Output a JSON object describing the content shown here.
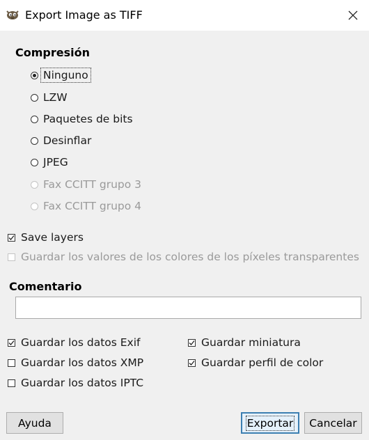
{
  "window": {
    "title": "Export Image as TIFF"
  },
  "compression": {
    "title": "Compresión",
    "options": [
      {
        "label": "Ninguno",
        "checked": true,
        "disabled": false
      },
      {
        "label": "LZW",
        "checked": false,
        "disabled": false
      },
      {
        "label": "Paquetes de bits",
        "checked": false,
        "disabled": false
      },
      {
        "label": "Desinflar",
        "checked": false,
        "disabled": false
      },
      {
        "label": "JPEG",
        "checked": false,
        "disabled": false
      },
      {
        "label": "Fax CCITT grupo 3",
        "checked": false,
        "disabled": true
      },
      {
        "label": "Fax CCITT grupo 4",
        "checked": false,
        "disabled": true
      }
    ]
  },
  "save_layers": {
    "label": "Save layers",
    "checked": true
  },
  "save_transparent": {
    "label": "Guardar los valores de los colores de los píxeles transparentes",
    "checked": false,
    "disabled": true
  },
  "comment": {
    "title": "Comentario",
    "value": ""
  },
  "metadata": {
    "exif": {
      "label": "Guardar los datos Exif",
      "checked": true
    },
    "xmp": {
      "label": "Guardar los datos XMP",
      "checked": false
    },
    "iptc": {
      "label": "Guardar los datos IPTC",
      "checked": false
    },
    "thumbnail": {
      "label": "Guardar miniatura",
      "checked": true
    },
    "color_profile": {
      "label": "Guardar perfil de color",
      "checked": true
    }
  },
  "buttons": {
    "help": "Ayuda",
    "export": "Exportar",
    "cancel": "Cancelar"
  },
  "icons": {
    "app": "gimp-icon",
    "close": "close-icon"
  }
}
